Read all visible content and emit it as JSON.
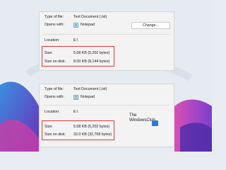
{
  "colors": {
    "highlight": "#e03a3a",
    "accent_blue": "#2b7bd6"
  },
  "dialog_top": {
    "type_of_file_label": "Type of file:",
    "type_of_file_value": "Text Document (.txt)",
    "opens_with_label": "Opens with:",
    "opens_with_app": "Notepad",
    "change_button": "Change...",
    "location_label": "Location:",
    "location_value": "E:\\",
    "size_label": "Size:",
    "size_value": "5.08 KB (5,202 bytes)",
    "size_on_disk_label": "Size on disk:",
    "size_on_disk_value": "8.00 KB (8,144 bytes)"
  },
  "dialog_bottom": {
    "type_of_file_label": "Type of file:",
    "type_of_file_value": "Text Document (.txt)",
    "opens_with_label": "Opens with:",
    "opens_with_app": "Notepad",
    "location_label": "Location:",
    "location_value": "E:\\",
    "size_label": "Size:",
    "size_value": "5.08 KB (5,202 bytes)",
    "size_on_disk_label": "Size on disk:",
    "size_on_disk_value": "32.0 KB (32,768 bytes)"
  },
  "watermark": {
    "line1": "The",
    "line2": "WindowsClub"
  },
  "icons": {
    "app_icon": "notepad-icon",
    "logo_icon": "windowsclub-logo-icon"
  }
}
